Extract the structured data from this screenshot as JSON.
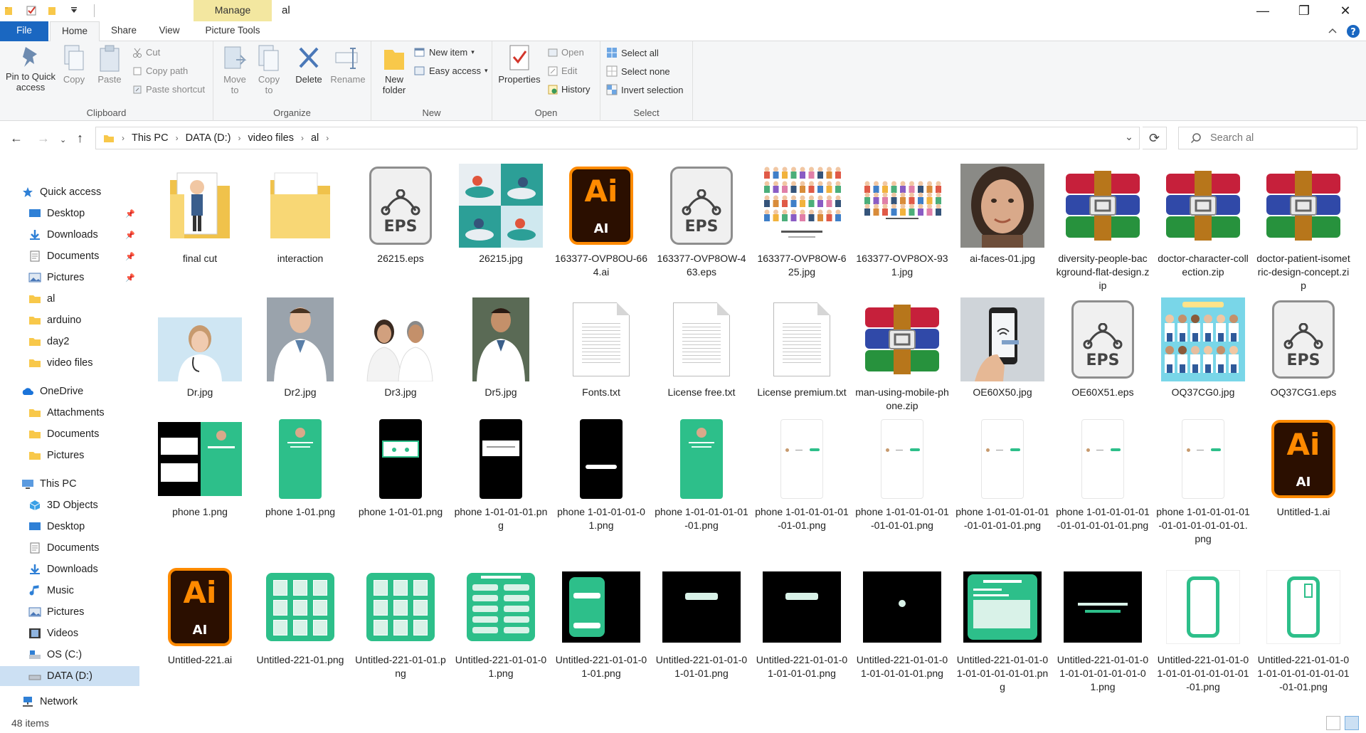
{
  "window": {
    "title": "al",
    "manage_label": "Manage",
    "minimize": "—",
    "maximize": "❐",
    "close": "✕"
  },
  "tabs": {
    "file": "File",
    "home": "Home",
    "share": "Share",
    "view": "View",
    "picture_tools": "Picture Tools"
  },
  "ribbon": {
    "clipboard": {
      "label": "Clipboard",
      "pin": "Pin to Quick access",
      "copy": "Copy",
      "paste": "Paste",
      "cut": "Cut",
      "copy_path": "Copy path",
      "paste_shortcut": "Paste shortcut"
    },
    "organize": {
      "label": "Organize",
      "move_to": "Move to",
      "copy_to": "Copy to",
      "delete": "Delete",
      "rename": "Rename"
    },
    "new": {
      "label": "New",
      "new_folder": "New folder",
      "new_item": "New item",
      "easy_access": "Easy access"
    },
    "open": {
      "label": "Open",
      "properties": "Properties",
      "open": "Open",
      "edit": "Edit",
      "history": "History"
    },
    "select": {
      "label": "Select",
      "select_all": "Select all",
      "select_none": "Select none",
      "invert": "Invert selection"
    }
  },
  "address": {
    "crumbs": [
      "This PC",
      "DATA (D:)",
      "video files",
      "al"
    ],
    "search_placeholder": "Search al"
  },
  "sidebar": {
    "quick_access": "Quick access",
    "qa_items": [
      "Desktop",
      "Downloads",
      "Documents",
      "Pictures",
      "al",
      "arduino",
      "day2",
      "video files"
    ],
    "onedrive": "OneDrive",
    "od_items": [
      "Attachments",
      "Documents",
      "Pictures"
    ],
    "this_pc": "This PC",
    "pc_items": [
      "3D Objects",
      "Desktop",
      "Documents",
      "Downloads",
      "Music",
      "Pictures",
      "Videos",
      "OS (C:)",
      "DATA (D:)"
    ],
    "network": "Network"
  },
  "files": [
    {
      "name": "final cut",
      "type": "folder-person"
    },
    {
      "name": "interaction",
      "type": "folder"
    },
    {
      "name": "26215.eps",
      "type": "eps"
    },
    {
      "name": "26215.jpg",
      "type": "collage"
    },
    {
      "name": "163377-OVP8OU-664.ai",
      "type": "ai"
    },
    {
      "name": "163377-OVP8OW-463.eps",
      "type": "eps"
    },
    {
      "name": "163377-OVP8OW-625.jpg",
      "type": "people"
    },
    {
      "name": "163377-OVP8OX-931.jpg",
      "type": "people2"
    },
    {
      "name": "ai-faces-01.jpg",
      "type": "face"
    },
    {
      "name": "diversity-people-background-flat-design.zip",
      "type": "zip"
    },
    {
      "name": "doctor-character-collection.zip",
      "type": "zip"
    },
    {
      "name": "doctor-patient-isometric-design-concept.zip",
      "type": "zip"
    },
    {
      "name": "Dr.jpg",
      "type": "doctor-w"
    },
    {
      "name": "Dr2.jpg",
      "type": "doctor-m"
    },
    {
      "name": "Dr3.jpg",
      "type": "doctor-pair"
    },
    {
      "name": "Dr5.jpg",
      "type": "doctor-m2"
    },
    {
      "name": "Fonts.txt",
      "type": "txt"
    },
    {
      "name": "License free.txt",
      "type": "txt"
    },
    {
      "name": "License premium.txt",
      "type": "txt"
    },
    {
      "name": "man-using-mobile-phone.zip",
      "type": "zip"
    },
    {
      "name": "OE60X50.jpg",
      "type": "phone-hand"
    },
    {
      "name": "OE60X51.eps",
      "type": "eps"
    },
    {
      "name": "OQ37CG0.jpg",
      "type": "doctors-group"
    },
    {
      "name": "OQ37CG1.eps",
      "type": "eps"
    },
    {
      "name": "phone 1.png",
      "type": "png-dual"
    },
    {
      "name": "phone 1-01.png",
      "type": "png-green"
    },
    {
      "name": "phone 1-01-01.png",
      "type": "png-black-card"
    },
    {
      "name": "phone 1-01-01-01.png",
      "type": "png-black-white"
    },
    {
      "name": "phone 1-01-01-01-01.png",
      "type": "png-black-bar"
    },
    {
      "name": "phone 1-01-01-01-01-01.png",
      "type": "png-green"
    },
    {
      "name": "phone 1-01-01-01-01-01-01.png",
      "type": "png-white"
    },
    {
      "name": "phone 1-01-01-01-01-01-01-01.png",
      "type": "png-white"
    },
    {
      "name": "phone 1-01-01-01-01-01-01-01-01.png",
      "type": "png-white"
    },
    {
      "name": "phone 1-01-01-01-01-01-01-01-01-01.png",
      "type": "png-white"
    },
    {
      "name": "phone 1-01-01-01-01-01-01-01-01-01-01.png",
      "type": "png-white"
    },
    {
      "name": "Untitled-1.ai",
      "type": "ai"
    },
    {
      "name": "Untitled-221.ai",
      "type": "ai"
    },
    {
      "name": "Untitled-221-01.png",
      "type": "grid-green"
    },
    {
      "name": "Untitled-221-01-01.png",
      "type": "grid-green"
    },
    {
      "name": "Untitled-221-01-01-01.png",
      "type": "exercises"
    },
    {
      "name": "Untitled-221-01-01-01-01.png",
      "type": "black-green-card"
    },
    {
      "name": "Untitled-221-01-01-01-01-01.png",
      "type": "black-pill"
    },
    {
      "name": "Untitled-221-01-01-01-01-01-01.png",
      "type": "black-pill"
    },
    {
      "name": "Untitled-221-01-01-01-01-01-01-01.png",
      "type": "black-dot"
    },
    {
      "name": "Untitled-221-01-01-01-01-01-01-01-01.png",
      "type": "green-form"
    },
    {
      "name": "Untitled-221-01-01-01-01-01-01-01-01-01.png",
      "type": "black-lines"
    },
    {
      "name": "Untitled-221-01-01-01-01-01-01-01-01-01-01.png",
      "type": "outline-phone"
    },
    {
      "name": "Untitled-221-01-01-01-01-01-01-01-01-01-01-01.png",
      "type": "outline-phone2"
    }
  ],
  "status": {
    "count": "48 items"
  },
  "colors": {
    "accent": "#1a67c1",
    "manage_tab": "#f3e7a0",
    "folder": "#f8d775",
    "app_green": "#2dbf8a",
    "ai_orange": "#ff8a00"
  }
}
